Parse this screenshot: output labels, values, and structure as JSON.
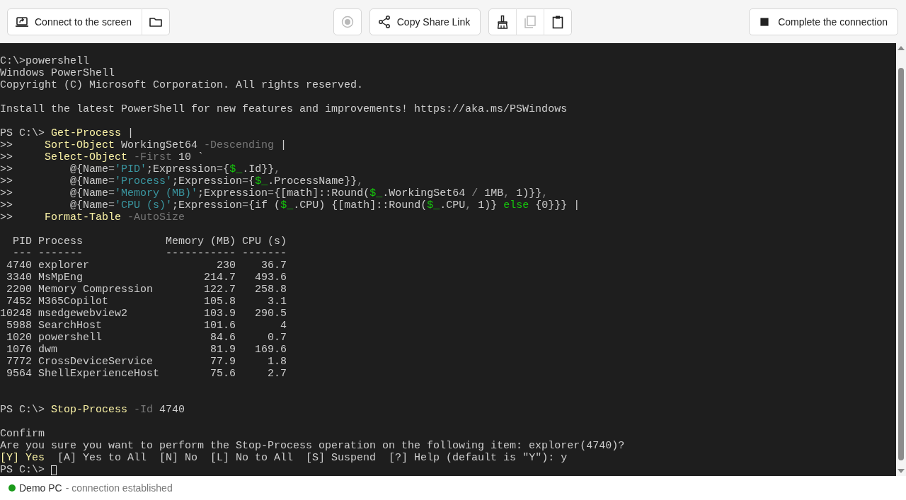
{
  "toolbar": {
    "buttons": [
      {
        "label": "Connect to the screen",
        "disabled": false
      },
      {
        "disabled": false
      },
      {
        "disabled": true
      },
      {
        "label": "Copy Share Link",
        "disabled": false
      },
      {
        "disabled": false
      },
      {
        "disabled": true
      },
      {
        "disabled": false
      },
      {
        "label": "Complete the connection",
        "disabled": false
      }
    ]
  },
  "terminal": {
    "blocks": [
      {
        "kind": "line",
        "segs": [
          {
            "kind": "plain",
            "text": "C:\\>powershell"
          }
        ]
      },
      {
        "kind": "line",
        "segs": [
          {
            "kind": "plain",
            "text": "Windows PowerShell"
          }
        ]
      },
      {
        "kind": "line",
        "segs": [
          {
            "kind": "plain",
            "text": "Copyright (C) Microsoft Corporation. All rights reserved."
          }
        ]
      },
      {
        "kind": "blank"
      },
      {
        "kind": "line",
        "segs": [
          {
            "kind": "plain",
            "text": "Install the latest PowerShell for new features and improvements! https://aka.ms/PSWindows"
          }
        ]
      },
      {
        "kind": "blank"
      },
      {
        "kind": "line",
        "segs": [
          {
            "kind": "plain",
            "text": "PS C:\\> "
          },
          {
            "kind": "command",
            "text": "Get-Process"
          },
          {
            "kind": "plain",
            "text": " |"
          }
        ]
      },
      {
        "kind": "line",
        "segs": [
          {
            "kind": "plain",
            "text": ">>     "
          },
          {
            "kind": "command",
            "text": "Sort-Object"
          },
          {
            "kind": "plain",
            "text": " WorkingSet64 "
          },
          {
            "kind": "param",
            "text": "-Descending"
          },
          {
            "kind": "plain",
            "text": " |"
          }
        ]
      },
      {
        "kind": "line",
        "segs": [
          {
            "kind": "plain",
            "text": ">>     "
          },
          {
            "kind": "command",
            "text": "Select-Object"
          },
          {
            "kind": "param",
            "text": " -First"
          },
          {
            "kind": "plain",
            "text": " 10 `"
          }
        ]
      },
      {
        "kind": "line",
        "segs": [
          {
            "kind": "plain",
            "text": ">>         @{Name"
          },
          {
            "kind": "operator",
            "text": "="
          },
          {
            "kind": "string",
            "text": "'PID'"
          },
          {
            "kind": "plain",
            "text": ";Expression"
          },
          {
            "kind": "operator",
            "text": "="
          },
          {
            "kind": "plain",
            "text": "{"
          },
          {
            "kind": "variable",
            "text": "$_"
          },
          {
            "kind": "plain",
            "text": ".Id}}"
          },
          {
            "kind": "operator",
            "text": ","
          }
        ]
      },
      {
        "kind": "line",
        "segs": [
          {
            "kind": "plain",
            "text": ">>         @{Name"
          },
          {
            "kind": "operator",
            "text": "="
          },
          {
            "kind": "string",
            "text": "'Process'"
          },
          {
            "kind": "plain",
            "text": ";Expression"
          },
          {
            "kind": "operator",
            "text": "="
          },
          {
            "kind": "plain",
            "text": "{"
          },
          {
            "kind": "variable",
            "text": "$_"
          },
          {
            "kind": "plain",
            "text": ".ProcessName}}"
          },
          {
            "kind": "operator",
            "text": ","
          }
        ]
      },
      {
        "kind": "line",
        "segs": [
          {
            "kind": "plain",
            "text": ">>         @{Name"
          },
          {
            "kind": "operator",
            "text": "="
          },
          {
            "kind": "string",
            "text": "'Memory (MB)'"
          },
          {
            "kind": "plain",
            "text": ";Expression"
          },
          {
            "kind": "operator",
            "text": "="
          },
          {
            "kind": "plain",
            "text": "{[math]::Round("
          },
          {
            "kind": "variable",
            "text": "$_"
          },
          {
            "kind": "plain",
            "text": ".WorkingSet64 "
          },
          {
            "kind": "operator",
            "text": "/"
          },
          {
            "kind": "plain",
            "text": " 1MB"
          },
          {
            "kind": "operator",
            "text": ","
          },
          {
            "kind": "plain",
            "text": " 1)}}"
          },
          {
            "kind": "operator",
            "text": ","
          }
        ]
      },
      {
        "kind": "line",
        "segs": [
          {
            "kind": "plain",
            "text": ">>         @{Name"
          },
          {
            "kind": "operator",
            "text": "="
          },
          {
            "kind": "string",
            "text": "'CPU (s)'"
          },
          {
            "kind": "plain",
            "text": ";Expression"
          },
          {
            "kind": "operator",
            "text": "="
          },
          {
            "kind": "plain",
            "text": "{if ("
          },
          {
            "kind": "variable",
            "text": "$_"
          },
          {
            "kind": "plain",
            "text": ".CPU) {[math]::Round("
          },
          {
            "kind": "variable",
            "text": "$_"
          },
          {
            "kind": "plain",
            "text": ".CPU"
          },
          {
            "kind": "operator",
            "text": ","
          },
          {
            "kind": "plain",
            "text": " 1)} "
          },
          {
            "kind": "keyword",
            "text": "else"
          },
          {
            "kind": "plain",
            "text": " {0}}} |"
          }
        ]
      },
      {
        "kind": "line",
        "segs": [
          {
            "kind": "plain",
            "text": ">>     "
          },
          {
            "kind": "command",
            "text": "Format-Table"
          },
          {
            "kind": "param",
            "text": " -AutoSize"
          }
        ]
      },
      {
        "kind": "blank"
      },
      {
        "kind": "table",
        "columns": [
          {
            "label": "PID",
            "rule": "---"
          },
          {
            "label": "Process",
            "rule": "-------"
          },
          {
            "label": "Memory (MB)",
            "rule": "-----------"
          },
          {
            "label": "CPU (s)",
            "rule": "-------"
          }
        ],
        "rows": [
          [
            "4740",
            "explorer",
            "230",
            "36.7"
          ],
          [
            "3340",
            "MsMpEng",
            "214.7",
            "493.6"
          ],
          [
            "2200",
            "Memory Compression",
            "122.7",
            "258.8"
          ],
          [
            "7452",
            "M365Copilot",
            "105.8",
            "3.1"
          ],
          [
            "10248",
            "msedgewebview2",
            "103.9",
            "290.5"
          ],
          [
            "5988",
            "SearchHost",
            "101.6",
            "4"
          ],
          [
            "1020",
            "powershell",
            "84.6",
            "0.7"
          ],
          [
            "1076",
            "dwm",
            "81.9",
            "169.6"
          ],
          [
            "7772",
            "CrossDeviceService",
            "77.9",
            "1.8"
          ],
          [
            "9564",
            "ShellExperienceHost",
            "75.6",
            "2.7"
          ]
        ]
      },
      {
        "kind": "blank"
      },
      {
        "kind": "blank"
      },
      {
        "kind": "line",
        "segs": [
          {
            "kind": "plain",
            "text": "PS C:\\> "
          },
          {
            "kind": "command",
            "text": "Stop-Process"
          },
          {
            "kind": "param",
            "text": " -Id"
          },
          {
            "kind": "plain",
            "text": " 4740"
          }
        ]
      },
      {
        "kind": "blank"
      },
      {
        "kind": "line",
        "segs": [
          {
            "kind": "plain",
            "text": "Confirm"
          }
        ]
      },
      {
        "kind": "line",
        "segs": [
          {
            "kind": "plain",
            "text": "Are you sure you want to perform the Stop-Process operation on the following item: explorer(4740)?"
          }
        ]
      },
      {
        "kind": "line",
        "segs": [
          {
            "kind": "command",
            "text": "[Y] Yes"
          },
          {
            "kind": "plain",
            "text": "  [A] Yes to All  [N] No  [L] No to All  [S] Suspend  [?] Help (default is \"Y\"): y"
          }
        ]
      }
    ],
    "input_line": {
      "prompt": "PS C:\\> ",
      "cursor": true
    }
  },
  "status_bar": {
    "name": "Demo PC",
    "status": "- connection established",
    "connected": true
  }
}
